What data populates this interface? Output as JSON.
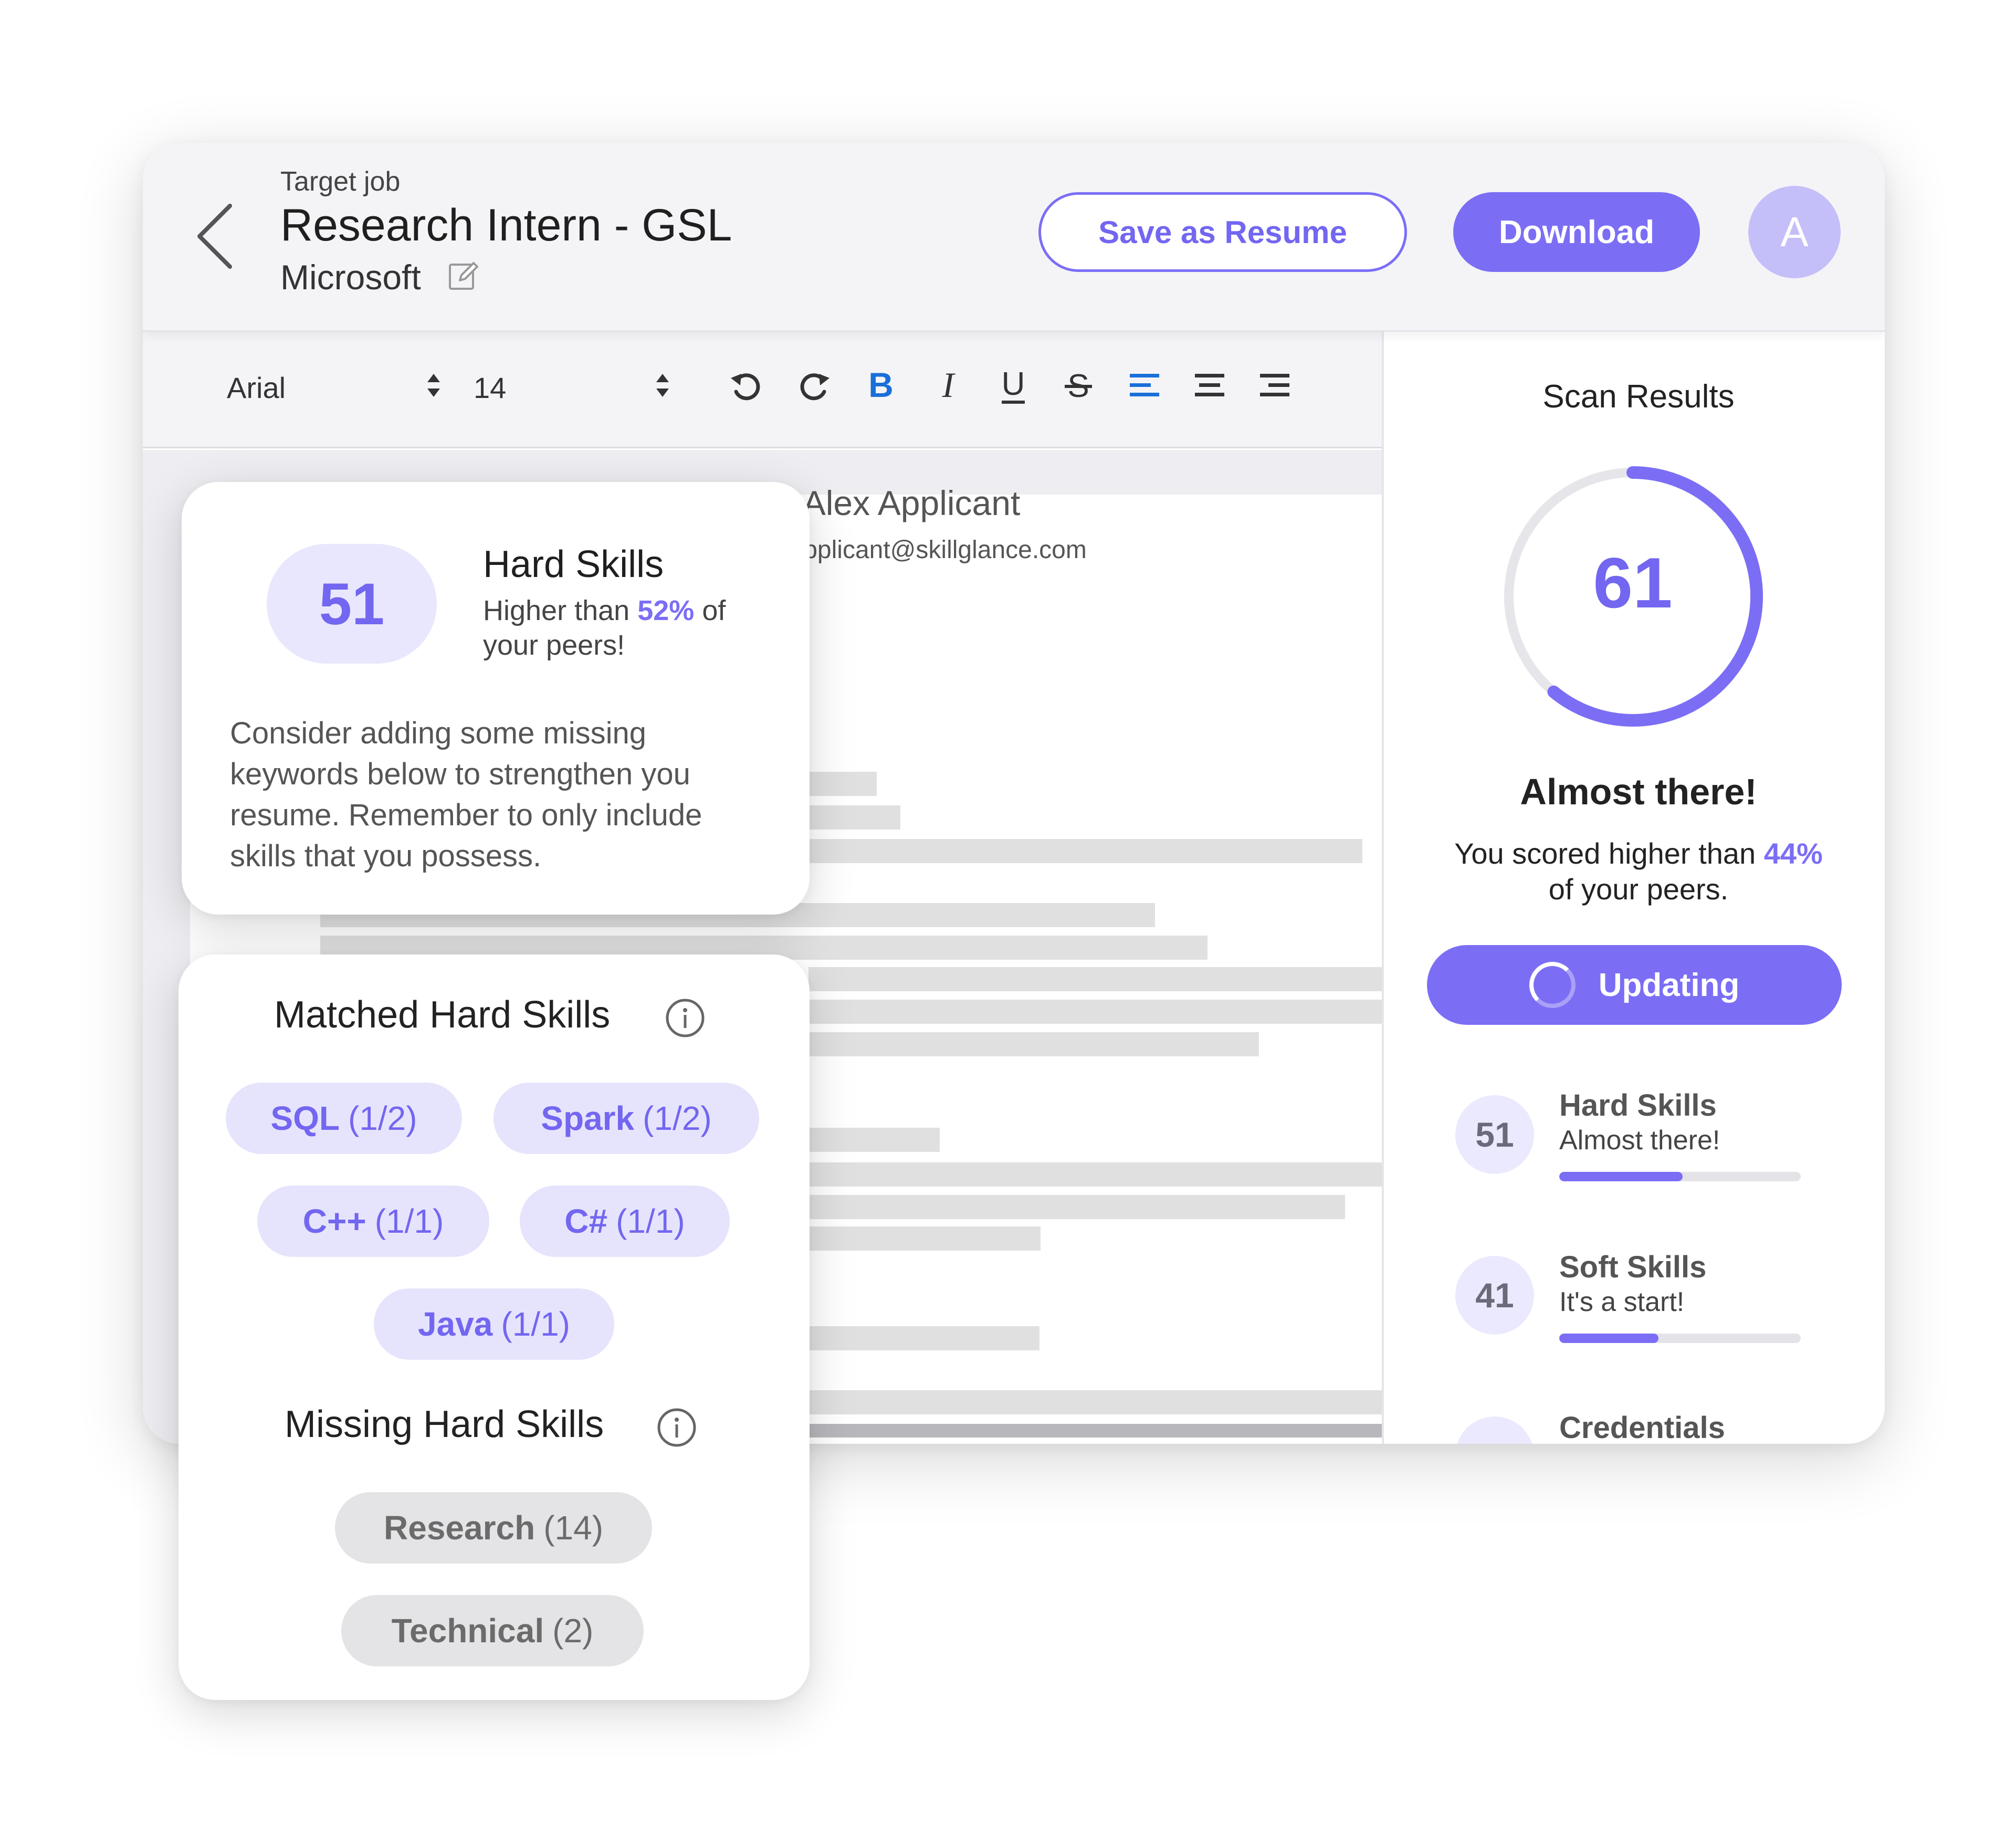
{
  "header": {
    "target_label": "Target job",
    "job_title": "Research Intern - GSL",
    "company": "Microsoft",
    "save_button": "Save as Resume",
    "download_button": "Download",
    "avatar_letter": "A",
    "icons": {
      "back": "chevron-left-icon",
      "edit": "pencil-icon"
    }
  },
  "toolbar": {
    "font_family": "Arial",
    "font_size": "14",
    "icons": [
      "undo-icon",
      "redo-icon",
      "bold-icon",
      "italic-icon",
      "underline-icon",
      "strikethrough-icon",
      "align-left-icon",
      "align-center-icon",
      "align-right-icon"
    ]
  },
  "resume": {
    "name": "Alex Applicant",
    "email": "alex.applicant@skillglance.com"
  },
  "scan": {
    "title": "Scan Results",
    "score": "61",
    "score_fraction": 0.61,
    "status": "Almost there!",
    "peers_prefix": "You scored higher than",
    "peers_percent": "44%",
    "peers_suffix": "of your peers.",
    "update_button": "Updating",
    "metrics": [
      {
        "score": "51",
        "name": "Hard Skills",
        "status": "Almost there!",
        "fraction": 0.51
      },
      {
        "score": "41",
        "name": "Soft Skills",
        "status": "It's a start!",
        "fraction": 0.41
      },
      {
        "name": "Credentials"
      }
    ]
  },
  "hard_skills_card": {
    "score": "51",
    "title": "Hard Skills",
    "sub_prefix": "Higher than",
    "sub_percent": "52%",
    "sub_of": "of",
    "sub_suffix": "your peers!",
    "advice": "Consider adding some missing keywords below to strengthen you resume. Remember to only include skills that you possess."
  },
  "skills_card": {
    "matched_title": "Matched Hard Skills",
    "missing_title": "Missing Hard Skills",
    "matched": [
      {
        "name": "SQL",
        "count": "(1/2)"
      },
      {
        "name": "Spark",
        "count": "(1/2)"
      },
      {
        "name": "C++",
        "count": "(1/1)"
      },
      {
        "name": "C#",
        "count": "(1/1)"
      },
      {
        "name": "Java",
        "count": "(1/1)"
      }
    ],
    "missing": [
      {
        "name": "Research",
        "count": "(14)"
      },
      {
        "name": "Technical",
        "count": "(2)"
      }
    ]
  },
  "colors": {
    "accent": "#7b6ef5",
    "accent_light": "#e9e7fd",
    "gray_chip": "#e4e4e6"
  }
}
